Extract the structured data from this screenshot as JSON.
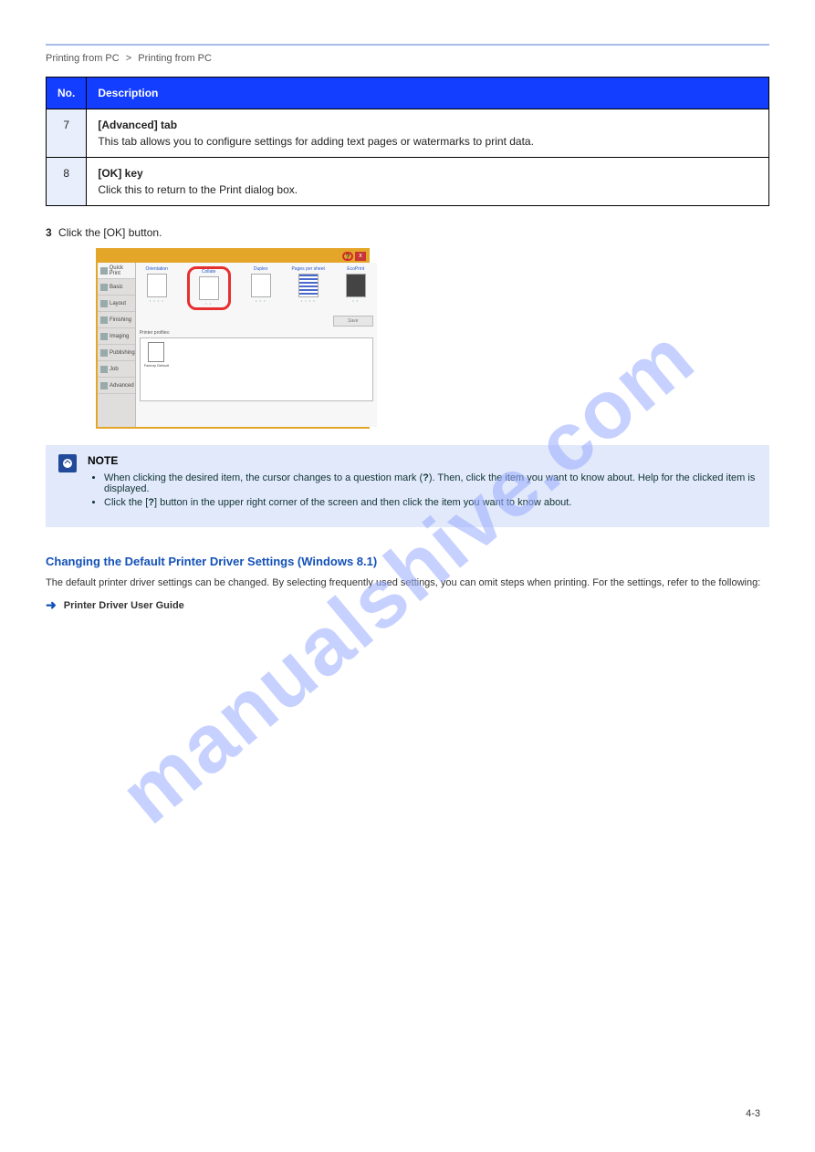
{
  "breadcrumb": {
    "a": "Printing from PC",
    "sep": ">",
    "b": "Printing from PC"
  },
  "table": {
    "head_no": "No.",
    "head_desc": "Description",
    "row1no": "7",
    "row1h": "[Advanced] tab",
    "row1d": "This tab allows you to configure settings for adding text pages or watermarks to print data.",
    "row2no": "8",
    "row2h": "[OK] key",
    "row2d": "Click this to return to the Print dialog box."
  },
  "step": {
    "num": "3",
    "text": "Click the [OK] button."
  },
  "screenshot": {
    "help_btn": "?",
    "close_btn": "x",
    "tabs": [
      "Quick Print",
      "Basic",
      "Layout",
      "Finishing",
      "Imaging",
      "Publishing",
      "Job",
      "Advanced"
    ],
    "opts": {
      "orientation": "Orientation",
      "collate": "Collate",
      "duplex": "Duplex",
      "pps": "Pages per sheet",
      "eco": "EcoPrint"
    },
    "save": "Save",
    "profiles_label": "Printer profiles:",
    "profile1": "Factory Default"
  },
  "note": {
    "head": "NOTE",
    "li1a": "When clicking the desired item, the cursor changes to a question mark (",
    "li1q": "?",
    "li1b": "). Then, click the item you want to know about. Help for the clicked item is displayed.",
    "li2a": "Click the [",
    "li2b": "?",
    "li2c": "] button in the upper right corner of the screen and then click the item you want to know about."
  },
  "subhead": "Changing the Default Printer Driver Settings (Windows 8.1)",
  "para": "The default printer driver settings can be changed. By selecting frequently used settings, you can omit steps when printing. For the settings, refer to the following:",
  "ref": {
    "text": "Printer Driver User Guide"
  },
  "pagenum": "4-3"
}
